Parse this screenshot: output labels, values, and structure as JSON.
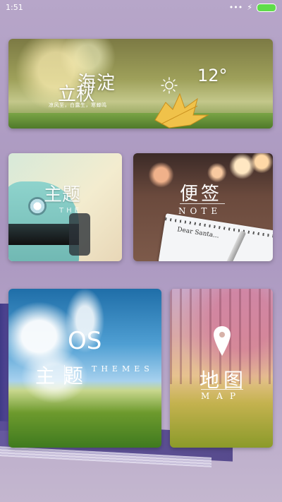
{
  "status_bar": {
    "time": "1:51",
    "icons": [
      "dots-icon",
      "charging-icon",
      "battery-icon"
    ]
  },
  "weather_card": {
    "city": "海淀",
    "solar_term": "立秋",
    "description": "凉风至，白露生，寒蝉鸣",
    "temperature": "12°",
    "weather_icon": "sun-icon"
  },
  "car_card": {
    "label": "主题",
    "sub": "THE"
  },
  "note_card": {
    "label": "便签",
    "sub": "NOTE",
    "pad_text": "Dear Santa..."
  },
  "theme_card": {
    "title": "OS",
    "label": "主题",
    "sub": "THEMES"
  },
  "map_card": {
    "label": "地图",
    "sub": "MAP",
    "pin_icon": "map-pin-icon"
  }
}
